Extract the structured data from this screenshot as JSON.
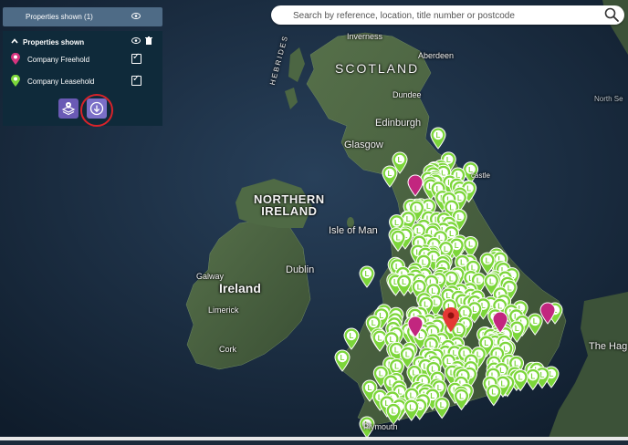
{
  "search": {
    "placeholder": "Search by reference, location, title number or postcode"
  },
  "panel": {
    "header": "Properties shown (1)",
    "title": "Properties shown",
    "layers": [
      {
        "label": "Company Freehold",
        "color": "#d6347e",
        "checked": true
      },
      {
        "label": "Company Leasehold",
        "color": "#7cd63a",
        "checked": true
      }
    ]
  },
  "map": {
    "labels": {
      "inverness": "Inverness",
      "aberdeen": "Aberdeen",
      "scotland": "SCOTLAND",
      "dundee": "Dundee",
      "hebrides": "HEBRIDES",
      "north_sea": "North Se",
      "edinburgh": "Edinburgh",
      "glasgow": "Glasgow",
      "newcastle_frag": "castle",
      "northern_ireland": "NORTHERN\nIRELAND",
      "isle_of_man": "Isle of Man",
      "dublin": "Dublin",
      "galway": "Galway",
      "ireland": "Ireland",
      "limerick": "Limerick",
      "cork": "Cork",
      "the_hague": "The Hag",
      "plymouth": "Plymouth"
    },
    "marker_letter": "L",
    "colors": {
      "leasehold": "#7cd63a",
      "freehold": "#c2267f",
      "selected": "#e53935",
      "land": "#3f5a3a",
      "sea": "#1a2b3e"
    }
  }
}
